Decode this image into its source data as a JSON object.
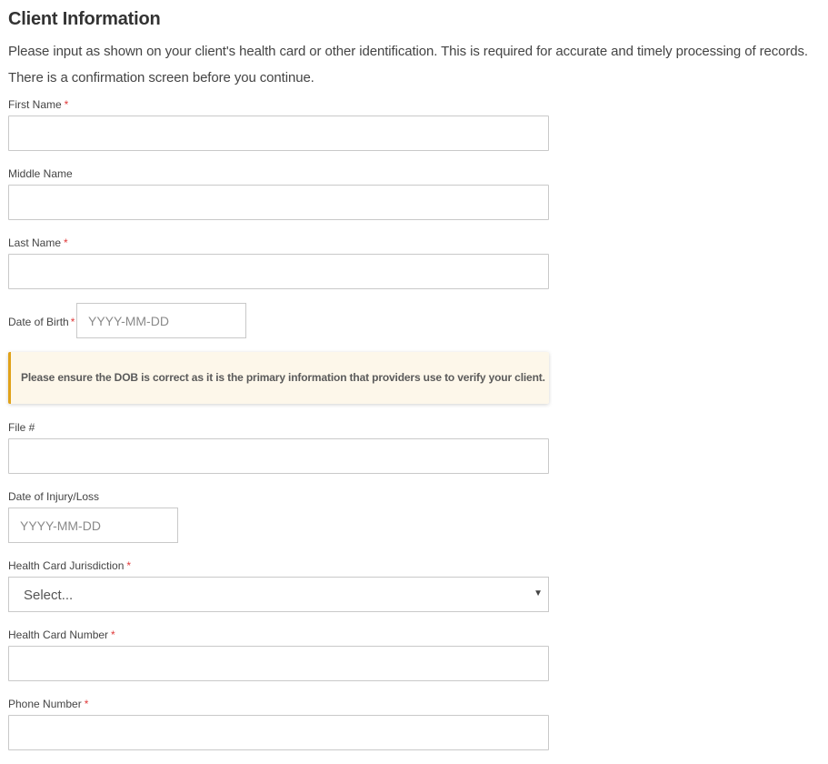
{
  "form": {
    "title": "Client Information",
    "intro_line1": "Please input as shown on your client's health card or other identification. This is required for accurate and timely processing of records.",
    "intro_line2": "There is a confirmation screen before you continue.",
    "required_marker": "*",
    "first_name": {
      "label": "First Name",
      "value": ""
    },
    "middle_name": {
      "label": "Middle Name",
      "value": ""
    },
    "last_name": {
      "label": "Last Name",
      "value": ""
    },
    "dob": {
      "label": "Date of Birth",
      "placeholder": "YYYY-MM-DD",
      "value": ""
    },
    "dob_notice": "Please ensure the DOB is correct as it is the primary information that providers use to verify your client.",
    "file_number": {
      "label": "File #",
      "value": ""
    },
    "date_of_injury": {
      "label": "Date of Injury/Loss",
      "placeholder": "YYYY-MM-DD",
      "value": ""
    },
    "jurisdiction": {
      "label": "Health Card Jurisdiction",
      "selected": "Select..."
    },
    "health_card_number": {
      "label": "Health Card Number",
      "value": ""
    },
    "phone_number": {
      "label": "Phone Number",
      "value": ""
    }
  },
  "colors": {
    "required": "#e03a3a",
    "notice_bg": "#fdf7ea",
    "notice_border": "#e0a21a"
  },
  "icons": {
    "select_arrow": "caret-down-icon"
  }
}
